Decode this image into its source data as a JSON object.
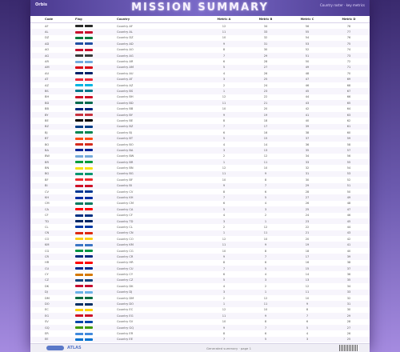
{
  "banner": {
    "brand": "Orbis",
    "title": "MISSION SUMMARY",
    "note": "Country roster · key metrics"
  },
  "table": {
    "columns": [
      "Code",
      "Flag",
      "Country",
      "Metric A",
      "Metric B",
      "Metric C",
      "Metric D"
    ],
    "rows": [
      {
        "code": "AF",
        "flag": "#2b2b2b",
        "name": "Country AF",
        "a": "12",
        "b": "34",
        "c": "56",
        "d": "78"
      },
      {
        "code": "AL",
        "flag": "#c8102e",
        "name": "Country AL",
        "a": "11",
        "b": "33",
        "c": "55",
        "d": "77"
      },
      {
        "code": "DZ",
        "flag": "#007a3d",
        "name": "Country DZ",
        "a": "10",
        "b": "32",
        "c": "54",
        "d": "76"
      },
      {
        "code": "AD",
        "flag": "#1f4ea3",
        "name": "Country AD",
        "a": "9",
        "b": "31",
        "c": "53",
        "d": "75"
      },
      {
        "code": "AO",
        "flag": "#c8102e",
        "name": "Country AO",
        "a": "8",
        "b": "30",
        "c": "52",
        "d": "74"
      },
      {
        "code": "AG",
        "flag": "#3a3a3a",
        "name": "Country AG",
        "a": "7",
        "b": "29",
        "c": "51",
        "d": "73"
      },
      {
        "code": "AR",
        "flag": "#74acdf",
        "name": "Country AR",
        "a": "6",
        "b": "28",
        "c": "50",
        "d": "72"
      },
      {
        "code": "AM",
        "flag": "#d90012",
        "name": "Country AM",
        "a": "5",
        "b": "27",
        "c": "49",
        "d": "71"
      },
      {
        "code": "AU",
        "flag": "#012169",
        "name": "Country AU",
        "a": "4",
        "b": "26",
        "c": "48",
        "d": "70"
      },
      {
        "code": "AT",
        "flag": "#ed2939",
        "name": "Country AT",
        "a": "3",
        "b": "25",
        "c": "47",
        "d": "69"
      },
      {
        "code": "AZ",
        "flag": "#00b5e2",
        "name": "Country AZ",
        "a": "2",
        "b": "24",
        "c": "46",
        "d": "68"
      },
      {
        "code": "BS",
        "flag": "#00778b",
        "name": "Country BS",
        "a": "1",
        "b": "23",
        "c": "45",
        "d": "67"
      },
      {
        "code": "BH",
        "flag": "#ce1126",
        "name": "Country BH",
        "a": "12",
        "b": "22",
        "c": "44",
        "d": "66"
      },
      {
        "code": "BD",
        "flag": "#006a4e",
        "name": "Country BD",
        "a": "11",
        "b": "21",
        "c": "43",
        "d": "65"
      },
      {
        "code": "BB",
        "flag": "#00267f",
        "name": "Country BB",
        "a": "10",
        "b": "20",
        "c": "42",
        "d": "64"
      },
      {
        "code": "BY",
        "flag": "#c8313e",
        "name": "Country BY",
        "a": "9",
        "b": "19",
        "c": "41",
        "d": "63"
      },
      {
        "code": "BE",
        "flag": "#000000",
        "name": "Country BE",
        "a": "8",
        "b": "18",
        "c": "40",
        "d": "62"
      },
      {
        "code": "BZ",
        "flag": "#003f87",
        "name": "Country BZ",
        "a": "7",
        "b": "17",
        "c": "39",
        "d": "61"
      },
      {
        "code": "BJ",
        "flag": "#008751",
        "name": "Country BJ",
        "a": "6",
        "b": "16",
        "c": "38",
        "d": "60"
      },
      {
        "code": "BT",
        "flag": "#ff4e12",
        "name": "Country BT",
        "a": "5",
        "b": "15",
        "c": "37",
        "d": "59"
      },
      {
        "code": "BO",
        "flag": "#d52b1e",
        "name": "Country BO",
        "a": "4",
        "b": "14",
        "c": "36",
        "d": "58"
      },
      {
        "code": "BA",
        "flag": "#002395",
        "name": "Country BA",
        "a": "3",
        "b": "13",
        "c": "35",
        "d": "57"
      },
      {
        "code": "BW",
        "flag": "#75aadb",
        "name": "Country BW",
        "a": "2",
        "b": "12",
        "c": "34",
        "d": "56"
      },
      {
        "code": "BR",
        "flag": "#009c3b",
        "name": "Country BR",
        "a": "1",
        "b": "11",
        "c": "33",
        "d": "55"
      },
      {
        "code": "BN",
        "flag": "#f7e017",
        "name": "Country BN",
        "a": "12",
        "b": "10",
        "c": "32",
        "d": "54"
      },
      {
        "code": "BG",
        "flag": "#00966e",
        "name": "Country BG",
        "a": "11",
        "b": "9",
        "c": "31",
        "d": "53"
      },
      {
        "code": "BF",
        "flag": "#ef2b2d",
        "name": "Country BF",
        "a": "10",
        "b": "8",
        "c": "30",
        "d": "52"
      },
      {
        "code": "BI",
        "flag": "#ce1126",
        "name": "Country BI",
        "a": "9",
        "b": "7",
        "c": "29",
        "d": "51"
      },
      {
        "code": "CV",
        "flag": "#003893",
        "name": "Country CV",
        "a": "8",
        "b": "6",
        "c": "28",
        "d": "50"
      },
      {
        "code": "KH",
        "flag": "#032ea1",
        "name": "Country KH",
        "a": "7",
        "b": "5",
        "c": "27",
        "d": "49"
      },
      {
        "code": "CM",
        "flag": "#007a5e",
        "name": "Country CM",
        "a": "6",
        "b": "4",
        "c": "26",
        "d": "48"
      },
      {
        "code": "CA",
        "flag": "#ff0000",
        "name": "Country CA",
        "a": "5",
        "b": "3",
        "c": "25",
        "d": "47"
      },
      {
        "code": "CF",
        "flag": "#003082",
        "name": "Country CF",
        "a": "4",
        "b": "2",
        "c": "24",
        "d": "46"
      },
      {
        "code": "TD",
        "flag": "#002664",
        "name": "Country TD",
        "a": "3",
        "b": "1",
        "c": "23",
        "d": "45"
      },
      {
        "code": "CL",
        "flag": "#0039a6",
        "name": "Country CL",
        "a": "2",
        "b": "12",
        "c": "22",
        "d": "44"
      },
      {
        "code": "CN",
        "flag": "#de2910",
        "name": "Country CN",
        "a": "1",
        "b": "11",
        "c": "21",
        "d": "43"
      },
      {
        "code": "CO",
        "flag": "#fcd116",
        "name": "Country CO",
        "a": "12",
        "b": "10",
        "c": "20",
        "d": "42"
      },
      {
        "code": "KM",
        "flag": "#3a75c4",
        "name": "Country KM",
        "a": "11",
        "b": "9",
        "c": "19",
        "d": "41"
      },
      {
        "code": "CG",
        "flag": "#009543",
        "name": "Country CG",
        "a": "10",
        "b": "8",
        "c": "18",
        "d": "40"
      },
      {
        "code": "CR",
        "flag": "#002b7f",
        "name": "Country CR",
        "a": "9",
        "b": "7",
        "c": "17",
        "d": "39"
      },
      {
        "code": "HR",
        "flag": "#ff0000",
        "name": "Country HR",
        "a": "8",
        "b": "6",
        "c": "16",
        "d": "38"
      },
      {
        "code": "CU",
        "flag": "#002a8f",
        "name": "Country CU",
        "a": "7",
        "b": "5",
        "c": "15",
        "d": "37"
      },
      {
        "code": "CY",
        "flag": "#d57800",
        "name": "Country CY",
        "a": "6",
        "b": "4",
        "c": "14",
        "d": "36"
      },
      {
        "code": "CZ",
        "flag": "#11457e",
        "name": "Country CZ",
        "a": "5",
        "b": "3",
        "c": "13",
        "d": "35"
      },
      {
        "code": "DK",
        "flag": "#c60c30",
        "name": "Country DK",
        "a": "4",
        "b": "2",
        "c": "12",
        "d": "34"
      },
      {
        "code": "DJ",
        "flag": "#6ab2e7",
        "name": "Country DJ",
        "a": "3",
        "b": "1",
        "c": "11",
        "d": "33"
      },
      {
        "code": "DM",
        "flag": "#006b3f",
        "name": "Country DM",
        "a": "2",
        "b": "12",
        "c": "10",
        "d": "32"
      },
      {
        "code": "DO",
        "flag": "#002d62",
        "name": "Country DO",
        "a": "1",
        "b": "11",
        "c": "9",
        "d": "31"
      },
      {
        "code": "EC",
        "flag": "#ffd100",
        "name": "Country EC",
        "a": "12",
        "b": "10",
        "c": "8",
        "d": "30"
      },
      {
        "code": "EG",
        "flag": "#ce1126",
        "name": "Country EG",
        "a": "11",
        "b": "9",
        "c": "7",
        "d": "29"
      },
      {
        "code": "SV",
        "flag": "#0047ab",
        "name": "Country SV",
        "a": "10",
        "b": "8",
        "c": "6",
        "d": "28"
      },
      {
        "code": "GQ",
        "flag": "#3e9a00",
        "name": "Country GQ",
        "a": "9",
        "b": "7",
        "c": "5",
        "d": "27"
      },
      {
        "code": "ER",
        "flag": "#4189dd",
        "name": "Country ER",
        "a": "8",
        "b": "6",
        "c": "4",
        "d": "26"
      },
      {
        "code": "EE",
        "flag": "#0072ce",
        "name": "Country EE",
        "a": "7",
        "b": "5",
        "c": "3",
        "d": "25"
      }
    ]
  },
  "footer": {
    "logo_text": "ATLAS",
    "note": "Generated summary · page 1"
  }
}
